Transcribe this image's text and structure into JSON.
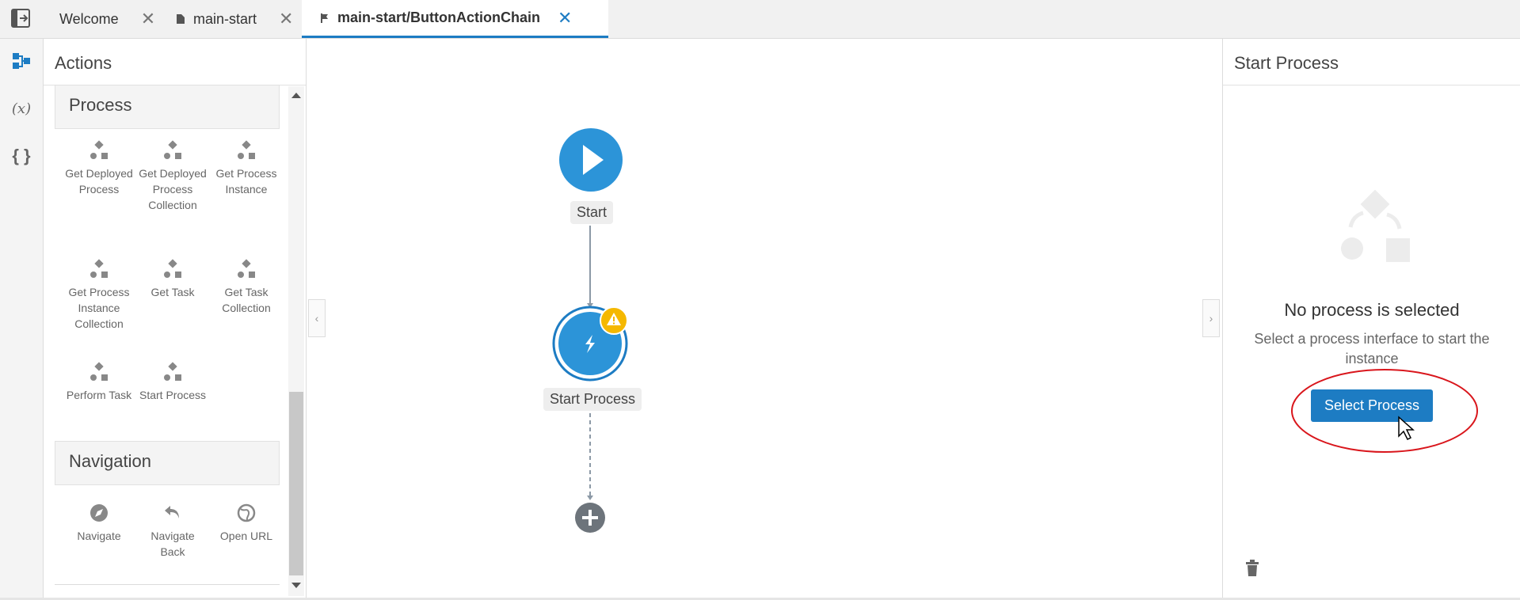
{
  "tabs": [
    {
      "label": "Welcome",
      "close": "✕"
    },
    {
      "label": "main-start",
      "close": "✕"
    },
    {
      "label": "main-start/ButtonActionChain",
      "close": "✕"
    }
  ],
  "rail": {
    "variables": "(x)",
    "types": "{ }"
  },
  "actions": {
    "title": "Actions",
    "sections": [
      {
        "name": "Process",
        "items": [
          {
            "label": "Get Deployed Process"
          },
          {
            "label": "Get Deployed Process Collection"
          },
          {
            "label": "Get Process Instance"
          },
          {
            "label": "Get Process Instance Collection"
          },
          {
            "label": "Get Task"
          },
          {
            "label": "Get Task Collection"
          },
          {
            "label": "Perform Task"
          },
          {
            "label": "Start Process"
          }
        ]
      },
      {
        "name": "Navigation",
        "items": [
          {
            "label": "Navigate"
          },
          {
            "label": "Navigate Back"
          },
          {
            "label": "Open URL"
          }
        ]
      }
    ]
  },
  "canvas": {
    "start_label": "Start",
    "action_label": "Start Process"
  },
  "properties": {
    "title": "Start Process",
    "empty_title": "No process is selected",
    "empty_text": "Select a process interface to start the instance",
    "button_label": "Select Process"
  },
  "colors": {
    "accent": "#1d7cc3",
    "node": "#2c94d8",
    "warning": "#f5b800",
    "highlight": "#d9161c"
  }
}
